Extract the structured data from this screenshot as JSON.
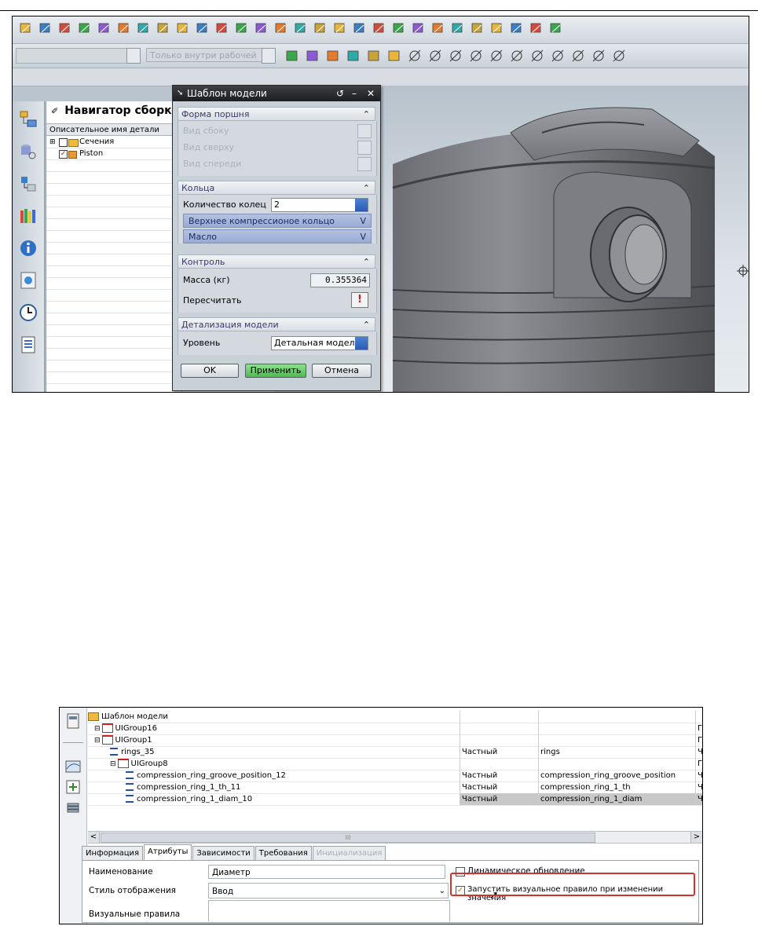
{
  "figure1": {
    "toolbar": {
      "filter_placeholder": "Только внутри рабочей",
      "icons_row1": [
        "new-file-icon",
        "block-icon",
        "cylinder-icon",
        "cone-icon",
        "sphere-icon",
        "extrude-icon",
        "revolve-icon",
        "sketch-icon",
        "datum-icon",
        "boolean-icon",
        "blend-icon",
        "chamfer-icon",
        "shell-icon",
        "draft-icon",
        "hole-icon",
        "pattern-icon",
        "mirror-icon",
        "trim-icon",
        "offset-icon",
        "thicken-icon",
        "sew-icon",
        "assembly-icon",
        "render-icon",
        "view-icon",
        "layer-icon",
        "analysis-icon",
        "grid-icon",
        "part-icon"
      ],
      "icons_row2": [
        "snap-icon",
        "select-filter-icon",
        "undo-arrow-icon",
        "shaded-icon",
        "move-icon",
        "rotate-icon",
        "selection-box-icon",
        "point-icon",
        "line-icon",
        "line2-icon",
        "arc-icon",
        "cross-icon",
        "circle-center-icon",
        "circle-icon",
        "plus-icon",
        "edge-icon",
        "solid-icon"
      ]
    },
    "side_tabs": [
      "assembly-navigator-icon",
      "part-navigator-icon",
      "constraints-icon",
      "reuse-library-icon",
      "info-icon",
      "web-icon",
      "history-icon",
      "roles-icon"
    ],
    "navigator": {
      "title": "Навигатор сборки",
      "column_header": "Описательное имя детали",
      "rows": [
        {
          "label": "Сечения"
        },
        {
          "label": "Piston"
        }
      ]
    },
    "dialog": {
      "title": "Шаблон модели",
      "sections": {
        "shape": {
          "title": "Форма поршня",
          "items": [
            "Вид сбоку",
            "Вид сверху",
            "Вид спереди"
          ]
        },
        "rings": {
          "title": "Кольца",
          "count_label": "Количество колец",
          "count_value": "2",
          "ring_items": [
            "Верхнее компрессионое кольцо",
            "Масло"
          ]
        },
        "control": {
          "title": "Контроль",
          "mass_label": "Масса (кг)",
          "mass_value": "0.355364",
          "recalc_label": "Пересчитать"
        },
        "detail": {
          "title": "Детализация модели",
          "level_label": "Уровень",
          "level_value": "Детальная модель"
        }
      },
      "buttons": {
        "ok": "OK",
        "apply": "Применить",
        "cancel": "Отмена"
      }
    }
  },
  "figure2": {
    "tree": [
      {
        "name": "Шаблон модели",
        "c1": "",
        "c2": "",
        "c3": ""
      },
      {
        "name": "UIGroup16",
        "c1": "",
        "c2": "",
        "c3": "Группа"
      },
      {
        "name": "UIGroup1",
        "c1": "",
        "c2": "",
        "c3": "Группа"
      },
      {
        "name": "rings_35",
        "c1": "Частный",
        "c2": "rings",
        "c3": "Числовое выраж"
      },
      {
        "name": "UIGroup8",
        "c1": "",
        "c2": "",
        "c3": "Группа"
      },
      {
        "name": "compression_ring_groove_position_12",
        "c1": "Частный",
        "c2": "compression_ring_groove_position",
        "c3": "Числовое выраж"
      },
      {
        "name": "compression_ring_1_th_11",
        "c1": "Частный",
        "c2": "compression_ring_1_th",
        "c3": "Числовое выраж"
      },
      {
        "name": "compression_ring_1_diam_10",
        "c1": "Частный",
        "c2": "compression_ring_1_diam",
        "c3": "Числовое выраж"
      }
    ],
    "scroll_glyph": "III",
    "tabs": [
      "Информация",
      "Атрибуты",
      "Зависимости",
      "Требования",
      "Инициализация"
    ],
    "attrs": {
      "name_label": "Наименование",
      "name_value": "Диаметр",
      "style_label": "Стиль отображения",
      "style_value": "Ввод",
      "rules_label": "Визуальные правила",
      "dynamic_label": "Динамическое обновление",
      "run_rule_label": "Запустить визуальное правило при изменении значения"
    }
  }
}
